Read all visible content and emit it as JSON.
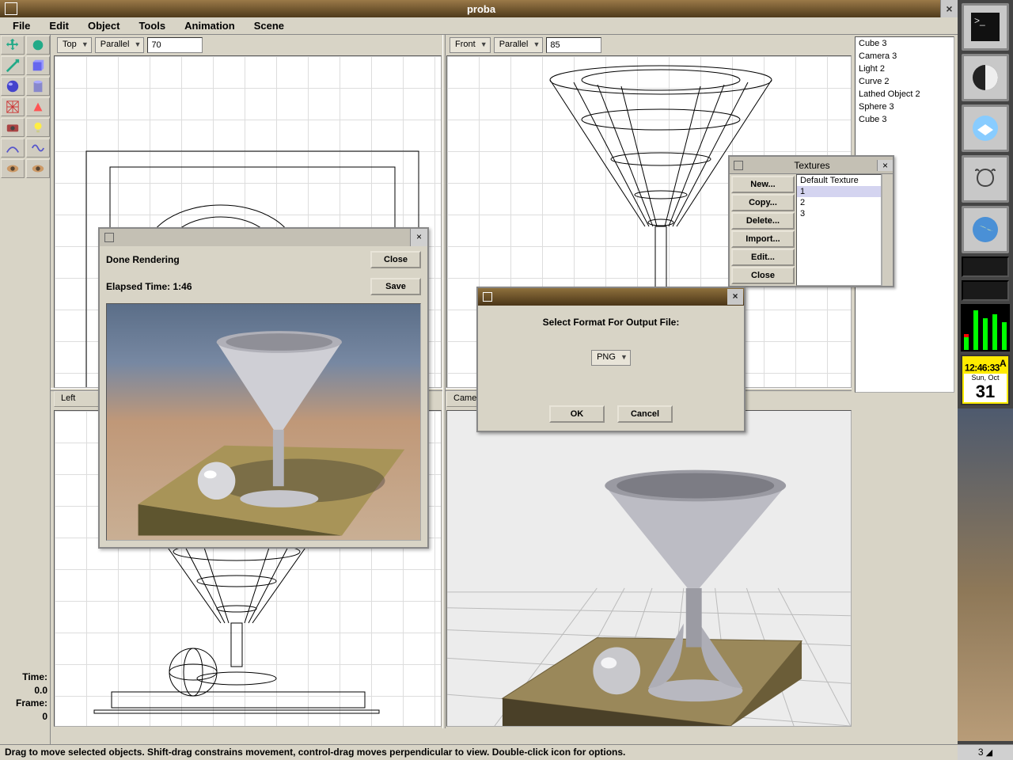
{
  "window": {
    "title": "proba"
  },
  "menu": [
    "File",
    "Edit",
    "Object",
    "Tools",
    "Animation",
    "Scene"
  ],
  "views": {
    "top": {
      "name": "Top",
      "proj": "Parallel",
      "zoom": "70"
    },
    "front": {
      "name": "Front",
      "proj": "Parallel",
      "zoom": "85"
    },
    "left_label": "Left",
    "camera_label": "Came"
  },
  "objects": [
    "Cube 3",
    "Camera 3",
    "Light 2",
    "Curve 2",
    "Lathed Object 2",
    "Sphere 3",
    "Cube 3"
  ],
  "textures": {
    "title": "Textures",
    "buttons": {
      "new": "New...",
      "copy": "Copy...",
      "delete": "Delete...",
      "import": "Import...",
      "edit": "Edit...",
      "close": "Close"
    },
    "items": [
      "Default Texture",
      "1",
      "2",
      "3"
    ],
    "selected_index": 1
  },
  "render": {
    "done": "Done Rendering",
    "elapsed": "Elapsed Time: 1:46",
    "close": "Close",
    "save": "Save"
  },
  "format_dialog": {
    "prompt": "Select Format For Output File:",
    "selected": "PNG",
    "ok": "OK",
    "cancel": "Cancel"
  },
  "statusbar": "Drag to move selected objects.  Shift-drag constrains movement, control-drag moves perpendicular to view.  Double-click icon for options.",
  "time_panel": {
    "l1": "Time:",
    "v1": "0.0",
    "l2": "Frame:",
    "v2": "0"
  },
  "dock": {
    "time": "12:46:33",
    "ampm": "A",
    "date": "Sun, Oct",
    "day": "31",
    "pager": "3"
  },
  "close_glyph": "×"
}
